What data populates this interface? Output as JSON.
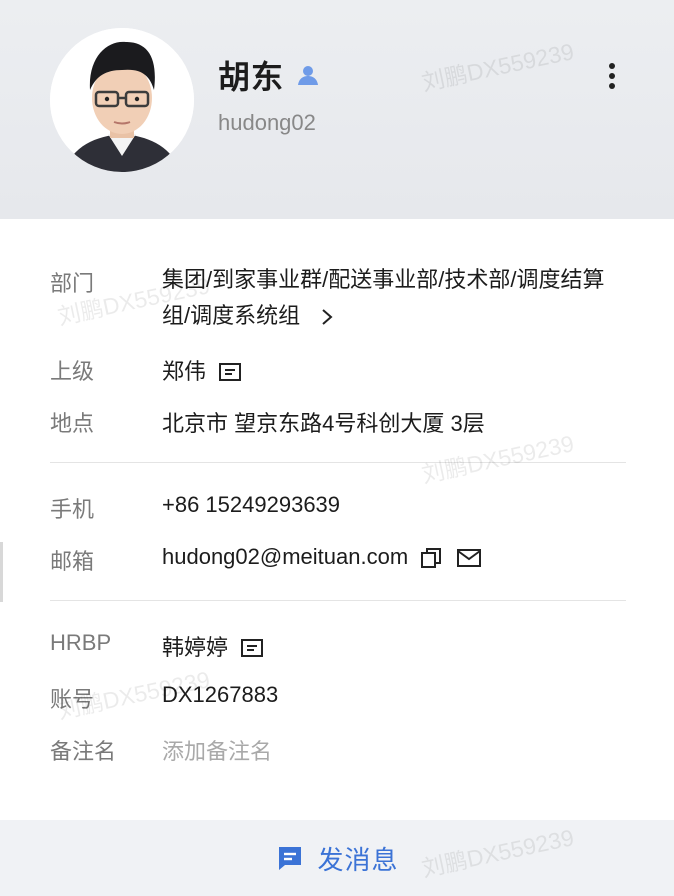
{
  "profile": {
    "name": "胡东",
    "username": "hudong02"
  },
  "fields": {
    "department": {
      "label": "部门",
      "value": "集团/到家事业群/配送事业部/技术部/调度结算组/调度系统组"
    },
    "manager": {
      "label": "上级",
      "value": "郑伟"
    },
    "location": {
      "label": "地点",
      "value": "北京市 望京东路4号科创大厦 3层"
    },
    "phone": {
      "label": "手机",
      "value": "+86 15249293639"
    },
    "email": {
      "label": "邮箱",
      "value": "hudong02@meituan.com"
    },
    "hrbp": {
      "label": "HRBP",
      "value": "韩婷婷"
    },
    "account": {
      "label": "账号",
      "value": "DX1267883"
    },
    "remark": {
      "label": "备注名",
      "placeholder": "添加备注名"
    }
  },
  "footer": {
    "send_message_label": "发消息"
  },
  "watermark": {
    "text": "刘鹏DX559239"
  },
  "colors": {
    "accent": "#3b73d6",
    "person_icon": "#6f9be8"
  },
  "icons": [
    "person-icon",
    "more-vertical-icon",
    "chevron-right-icon",
    "chat-icon",
    "copy-icon",
    "mail-icon",
    "message-icon"
  ]
}
